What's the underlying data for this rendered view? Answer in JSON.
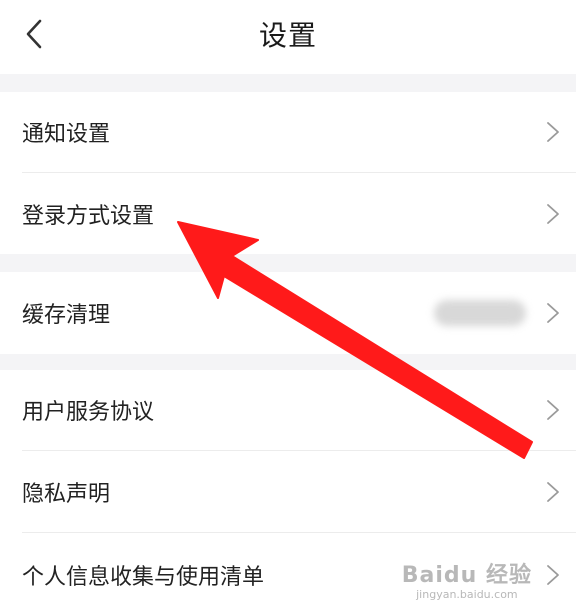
{
  "header": {
    "title": "设置",
    "back_icon": "chevron-left-icon"
  },
  "groups": [
    {
      "items": [
        {
          "label": "通知设置"
        },
        {
          "label": "登录方式设置"
        }
      ]
    },
    {
      "items": [
        {
          "label": "缓存清理",
          "value_blurred": true
        }
      ]
    },
    {
      "items": [
        {
          "label": "用户服务协议"
        },
        {
          "label": "隐私声明"
        },
        {
          "label": "个人信息收集与使用清单"
        }
      ]
    }
  ],
  "annotation": {
    "arrow_color": "#ff1a1a",
    "points_to": "登录方式设置"
  },
  "watermark": {
    "brand": "Baidu 经验",
    "domain": "jingyan.baidu.com"
  },
  "colors": {
    "background": "#ffffff",
    "separator": "#f4f4f6",
    "text": "#222222",
    "chevron": "#9a9a9a"
  }
}
